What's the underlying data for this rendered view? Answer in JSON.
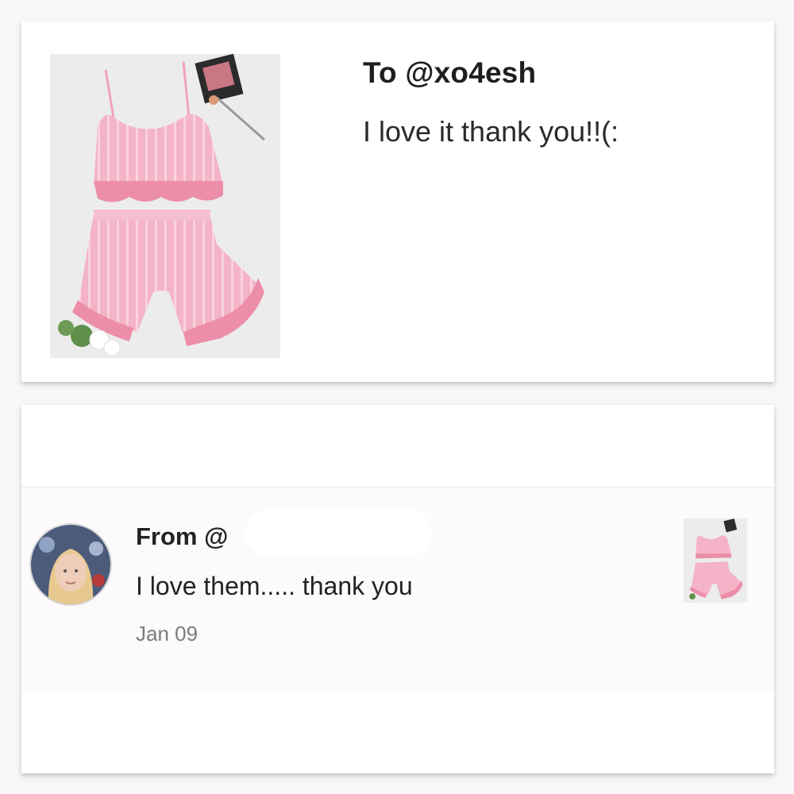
{
  "top_card": {
    "to_label": "To @xo4esh",
    "message": "I love it thank you!!(:",
    "image_icon": "product-photo-pink-satin-pajama-set"
  },
  "bottom_card": {
    "from_label": "From @",
    "message": "I love them..... thank you",
    "date": "Jan 09",
    "avatar_icon": "user-avatar",
    "thumb_icon": "product-thumbnail-pink-pajama-set"
  },
  "colors": {
    "pink": "#f2a9bd",
    "pink_dark": "#e98aa6",
    "card_bg": "#ffffff",
    "page_bg": "#f7f7f7"
  }
}
